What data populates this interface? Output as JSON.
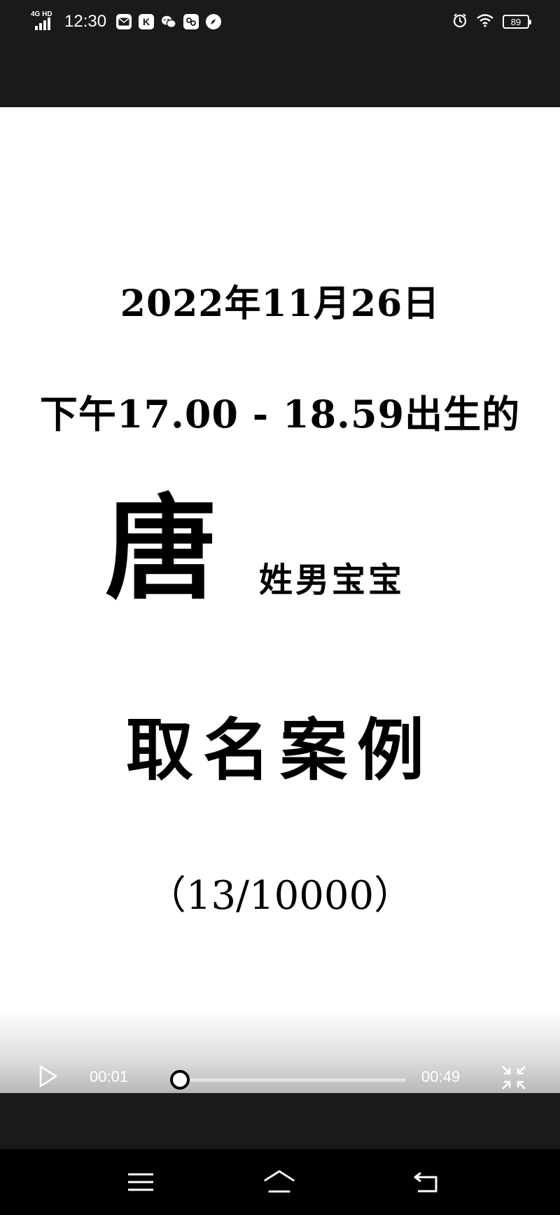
{
  "status_bar": {
    "network": "4G HD",
    "time": "12:30",
    "app_icons": [
      "mail-icon",
      "k-app-icon",
      "wechat-icon",
      "gallery-icon",
      "compass-icon"
    ],
    "k_label": "K",
    "battery_level": "89",
    "right_icons": [
      "alarm-icon",
      "wifi-icon",
      "battery-icon"
    ]
  },
  "video": {
    "line_date": "2022年11月26日",
    "line_time": "下午17.00 - 18.59出生的",
    "surname": "唐",
    "surname_sub": "姓男宝宝",
    "line_case": "取名案例",
    "line_count": "（13/10000）"
  },
  "player": {
    "current_time": "00:01",
    "total_time": "00:49",
    "progress_fraction": 0.02,
    "icons": [
      "play-icon",
      "exit-fullscreen-icon"
    ]
  },
  "nav": {
    "icons": [
      "menu-icon",
      "home-icon",
      "back-icon"
    ]
  },
  "colors": {
    "status_bg": "#1a1a1a",
    "video_bg": "#ffffff",
    "text": "#000000",
    "nav_bg": "#000000"
  }
}
